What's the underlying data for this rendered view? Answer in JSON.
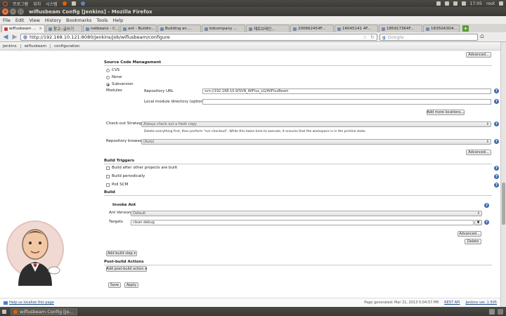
{
  "system_panel": {
    "menus": [
      "프로그램",
      "위치",
      "시스템"
    ],
    "time": "17:05",
    "user": "root"
  },
  "window": {
    "title": "wiflusbeam Config [Jenkins] - Mozilla Firefox"
  },
  "firefox_menu": [
    "File",
    "Edit",
    "View",
    "History",
    "Bookmarks",
    "Tools",
    "Help"
  ],
  "tabs": [
    {
      "label": "wiflusbeam ...",
      "active": true
    },
    {
      "label": "창고::글쓰기"
    },
    {
      "label": "netbeans - C..."
    },
    {
      "label": "ant - Buildin..."
    },
    {
      "label": "Building an ..."
    },
    {
      "label": "bdcompany ..."
    },
    {
      "label": "재로브레인..."
    },
    {
      "label": "200662454F..."
    },
    {
      "label": "16045141 4F..."
    },
    {
      "label": "185917364F..."
    },
    {
      "label": "18350A3D4..."
    }
  ],
  "navbar": {
    "url": "http://192.168.10.121:8080/jenkins/job/wiflusbeam/configure",
    "search_placeholder": "Google"
  },
  "breadcrumbs": [
    "Jenkins",
    "wiflusbeam",
    "configuration"
  ],
  "config": {
    "advanced_label": "Advanced...",
    "scm": {
      "title": "Source Code Management",
      "options": [
        "CVS",
        "None",
        "Subversion"
      ],
      "selected": "Subversion",
      "modules_label": "Modules",
      "repo_url_label": "Repository URL",
      "repo_url_value": "svn://192.168.10.9/SVN_WiFlus_LG/WiFlusBeam",
      "local_dir_label": "Local module directory (optional)",
      "local_dir_value": "",
      "add_locations_label": "Add more locations...",
      "checkout_strategy_label": "Check-out Strategy",
      "checkout_strategy_value": "Always check out a fresh copy",
      "checkout_strategy_desc": "Delete everything first, then perform \"svn checkout\". While this takes time to execute, it ensures that the workspace is in the pristine state.",
      "repo_browser_label": "Repository browser",
      "repo_browser_value": "(Auto)"
    },
    "triggers": {
      "title": "Build Triggers",
      "options": [
        "Build after other projects are built",
        "Build periodically",
        "Poll SCM"
      ]
    },
    "build": {
      "title": "Build",
      "step_title": "Invoke Ant",
      "ant_version_label": "Ant Version",
      "ant_version_value": "Default",
      "targets_label": "Targets",
      "targets_value": "clean debug",
      "delete_label": "Delete",
      "add_build_step_label": "Add build step"
    },
    "post_build": {
      "title": "Post-build Actions",
      "add_label": "Add post-build action"
    },
    "save_label": "Save",
    "apply_label": "Apply"
  },
  "footer": {
    "help_link": "Help us localize this page",
    "generated": "Page generated: Mar 21, 2013 5:04:57 PM",
    "rest_api": "REST API",
    "version": "Jenkins ver. 1.505"
  },
  "taskbar": {
    "task_label": "wiflusbeam Config [Je..."
  }
}
